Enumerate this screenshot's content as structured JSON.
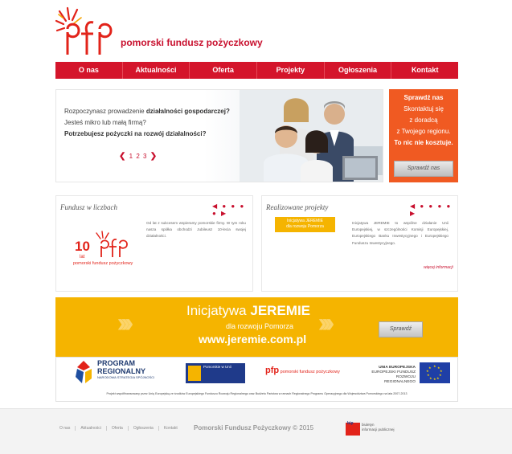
{
  "header": {
    "logo_text": "pfp",
    "brand": "pomorski fundusz pożyczkowy"
  },
  "nav": {
    "items": [
      "O nas",
      "Aktualności",
      "Oferta",
      "Projekty",
      "Ogłoszenia",
      "Kontakt"
    ]
  },
  "hero": {
    "line1_pre": "Rozpoczynasz prowadzenie ",
    "line1_bold": "działalności gospodarczej?",
    "line2": "Jesteś mikro lub małą firmą?",
    "line3": "Potrzebujesz pożyczki na rozwój działalności?",
    "pager": [
      "1",
      "2",
      "3"
    ]
  },
  "promo": {
    "line1": "Sprawdź nas",
    "line2": "Skontaktuj się",
    "line3": "z doradcą",
    "line4": "z Twojego regionu.",
    "line5": "To nic nie kosztuje.",
    "button": "Sprawdź nas"
  },
  "box1": {
    "title": "Fundusz w liczbach",
    "text": "Od lat z sukcesem wspieramy pomorskie firmy. W tym roku nasza spółka obchodzi Jubileusz 10-lecia swojej działalności.",
    "badge_number": "10",
    "badge_suffix": "lat",
    "badge_caption": "pomorski fundusz pożyczkowy"
  },
  "box2": {
    "title": "Realizowane projekty",
    "tag_bold": "Inicjatywa JEREMIE",
    "tag_sub": "dla rozwoju Pomorza",
    "text": "Inicjatywa JEREMIE to wspólne działanie Unii Europejskiej, w szczególności Komisji Europejskiej, Europejskiego Banku Inwestycyjnego i Europejskiego Funduszu Inwestycyjnego.",
    "more": "więcej informacji"
  },
  "banner": {
    "title_pre": "Inicjatywa ",
    "title_bold": "JEREMIE",
    "subtitle": "dla rozwoju Pomorza",
    "url": "www.jeremie.com.pl",
    "button": "Sprawdź"
  },
  "logos": {
    "program_line1": "PROGRAM",
    "program_line2": "REGIONALNY",
    "program_line3": "NARODOWA STRATEGIA SPÓJNOŚCI",
    "pomorskie": "Pomorskie w Unii",
    "pfp": "pomorski fundusz pożyczkowy",
    "ue_line1": "UNIA EUROPEJSKA",
    "ue_line2": "EUROPEJSKI FUNDUSZ",
    "ue_line3": "ROZWOJU REGIONALNEGO",
    "footnote": "Projekt współfinansowany przez Unię Europejską ze środków Europejskiego Funduszu Rozwoju Regionalnego oraz Budżetu Państwa w ramach Regionalnego Programu Operacyjnego dla Województwa Pomorskiego na lata 2007-2013"
  },
  "footer": {
    "nav": [
      "O nas",
      "Aktualności",
      "Oferta",
      "Ogłoszenia",
      "Kontakt"
    ],
    "copyright_name": "Pomorski Fundusz Pożyczkowy",
    "copyright_year": " © 2015",
    "bip_line1": "biuletyn",
    "bip_line2": "informacji publicznej",
    "bip": "bip"
  },
  "colors": {
    "brand_red": "#d4152b",
    "orange": "#f05a22",
    "yellow": "#f5b400"
  }
}
